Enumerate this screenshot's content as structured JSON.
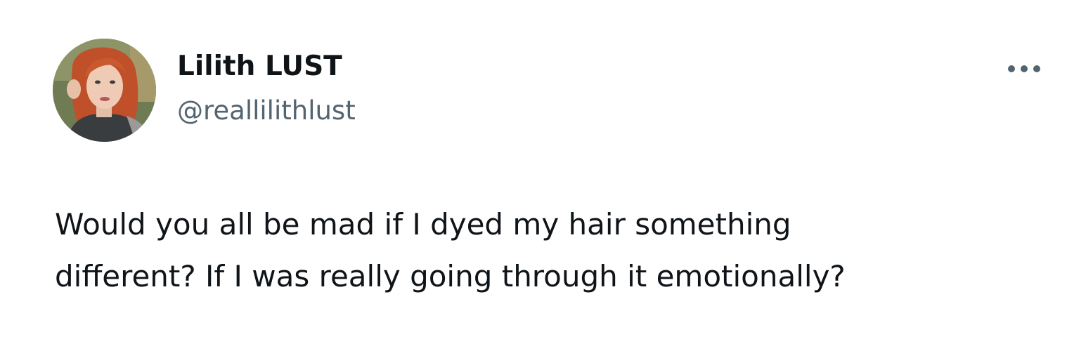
{
  "tweet": {
    "author": {
      "display_name": "Lilith LUST",
      "handle": "@reallilithlust",
      "avatar_icon": "profile-photo"
    },
    "more_icon": "more-options-icon",
    "text_lines": [
      "Would you all be mad if I dyed my hair something",
      "different? If I was really going through it emotionally?"
    ]
  },
  "colors": {
    "background": "#ffffff",
    "primary_text": "#0f1419",
    "secondary_text": "#536471"
  }
}
